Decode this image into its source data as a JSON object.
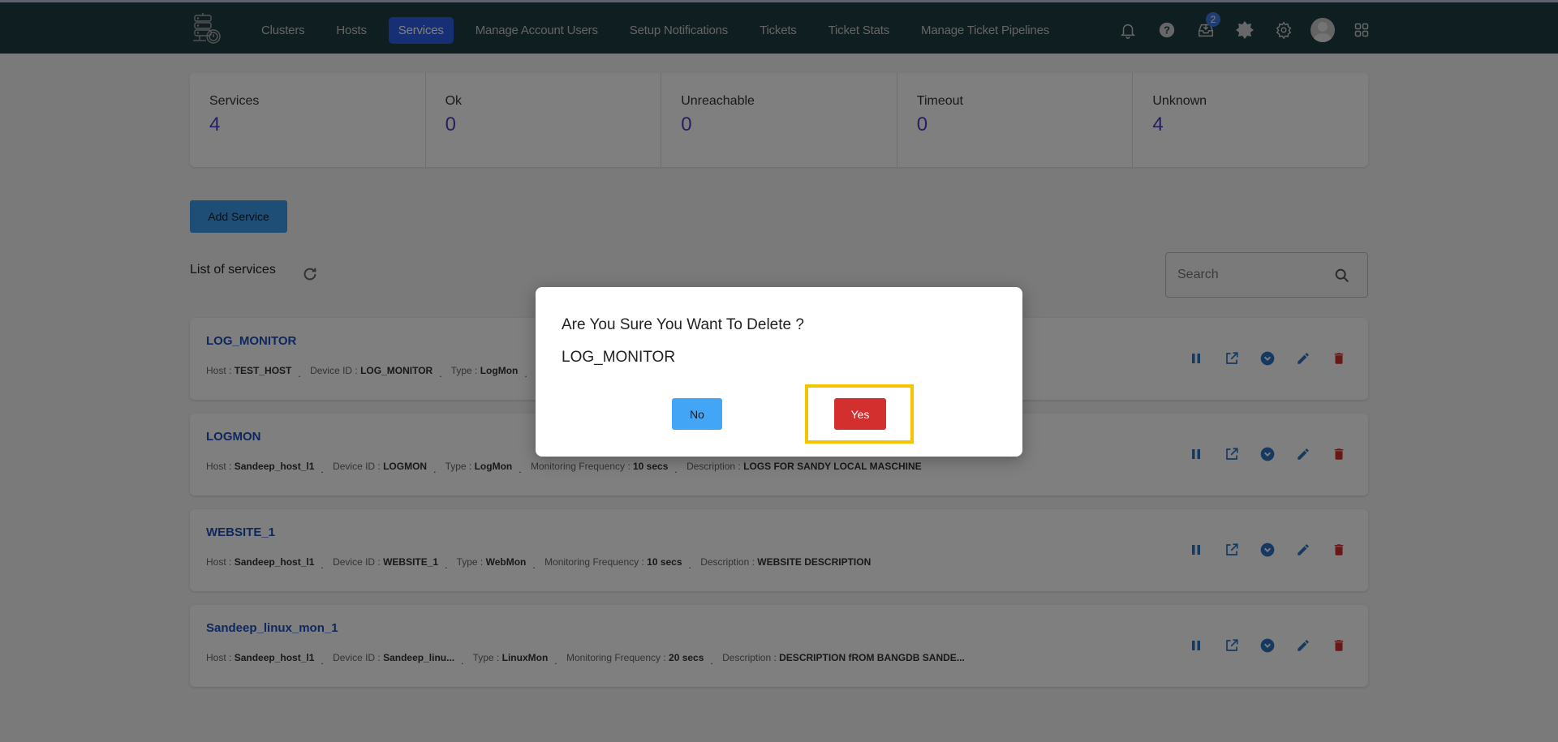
{
  "nav": {
    "items": [
      {
        "label": "Clusters",
        "active": false
      },
      {
        "label": "Hosts",
        "active": false
      },
      {
        "label": "Services",
        "active": true
      },
      {
        "label": "Manage Account Users",
        "active": false
      },
      {
        "label": "Setup Notifications",
        "active": false
      },
      {
        "label": "Tickets",
        "active": false
      },
      {
        "label": "Ticket Stats",
        "active": false
      },
      {
        "label": "Manage Ticket Pipelines",
        "active": false
      }
    ],
    "inbox_badge": "2",
    "icons": [
      "bell-icon",
      "help-icon",
      "inbox-download-icon",
      "theme-toggle-icon",
      "settings-gear-icon",
      "user-avatar",
      "apps-grid-icon"
    ]
  },
  "stats": [
    {
      "label": "Services",
      "value": "4"
    },
    {
      "label": "Ok",
      "value": "0"
    },
    {
      "label": "Unreachable",
      "value": "0"
    },
    {
      "label": "Timeout",
      "value": "0"
    },
    {
      "label": "Unknown",
      "value": "4"
    }
  ],
  "add_service_label": "Add Service",
  "list_title": "List of services",
  "search": {
    "placeholder": "Search",
    "value": ""
  },
  "field_labels": {
    "host": "Host : ",
    "device_id": "Device ID : ",
    "type": "Type : ",
    "frequency": "Monitoring Frequency : ",
    "description": "Description : "
  },
  "services": [
    {
      "name": "LOG_MONITOR",
      "host": "TEST_HOST",
      "device_id": "LOG_MONITOR",
      "type": "LogMon",
      "frequency": "",
      "description": ""
    },
    {
      "name": "LOGMON",
      "host": "Sandeep_host_l1",
      "device_id": "LOGMON",
      "type": "LogMon",
      "frequency": "10 secs",
      "description": "LOGS FOR SANDY LOCAL MASCHINE"
    },
    {
      "name": "WEBSITE_1",
      "host": "Sandeep_host_l1",
      "device_id": "WEBSITE_1",
      "type": "WebMon",
      "frequency": "10 secs",
      "description": "WEBSITE DESCRIPTION"
    },
    {
      "name": "Sandeep_linux_mon_1",
      "host": "Sandeep_host_l1",
      "device_id": "Sandeep_linu...",
      "type": "LinuxMon",
      "frequency": "20 secs",
      "description": "DESCRIPTION fROM BANGDB SANDE..."
    }
  ],
  "row_action_icons": [
    "pause-icon",
    "open-external-icon",
    "expand-circle-icon",
    "edit-pencil-icon",
    "delete-trash-icon"
  ],
  "modal": {
    "title": "Are You Sure You Want To Delete ?",
    "item_name": "LOG_MONITOR",
    "no_label": "No",
    "yes_label": "Yes"
  },
  "colors": {
    "navbar": "#1e3c43",
    "active_nav": "#2e5ee8",
    "stat_value": "#4a3fc2",
    "service_link": "#1f4fbf",
    "action_blue": "#2a72c2",
    "delete_red": "#d32f2f",
    "highlight": "#f5c400"
  }
}
